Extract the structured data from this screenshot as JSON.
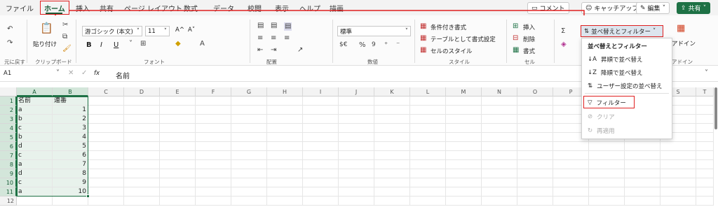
{
  "tabs": [
    "ファイル",
    "ホーム",
    "挿入",
    "共有",
    "ページ レイアウト",
    "数式",
    "データ",
    "校閲",
    "表示",
    "ヘルプ",
    "描画"
  ],
  "top_buttons": {
    "comment": "コメント",
    "catchup": "キャッチアップ",
    "edit": "編集",
    "share": "共有"
  },
  "ribbon": {
    "undo_group": "元に戻す",
    "clipboard": {
      "paste": "貼り付け",
      "label": "クリップボード"
    },
    "font": {
      "name": "游ゴシック (本文)",
      "size": "11",
      "label": "フォント",
      "grow": "A^",
      "shrink": "A˅",
      "bold": "B",
      "italic": "I",
      "underline": "U"
    },
    "alignment": {
      "label": "配置"
    },
    "number": {
      "format": "標準",
      "label": "数値"
    },
    "styles": {
      "conditional": "条件付き書式",
      "table": "テーブルとして書式設定",
      "cell_styles": "セルのスタイル",
      "label": "スタイル"
    },
    "cells": {
      "insert": "挿入",
      "delete": "削除",
      "format": "書式",
      "label": "セル"
    },
    "editing": {
      "sort_filter": "並べ替えとフィルター"
    },
    "addins": {
      "label": "アドイン",
      "label2": "アドイン"
    }
  },
  "formula_bar": {
    "name_box": "A1",
    "fx": "fx",
    "content": "名前"
  },
  "grid": {
    "columns": [
      "A",
      "B",
      "C",
      "D",
      "E",
      "F",
      "G",
      "H",
      "I",
      "J",
      "K",
      "L",
      "M",
      "N",
      "O",
      "P",
      "Q",
      "R",
      "S",
      "T"
    ],
    "rows": [
      "1",
      "2",
      "3",
      "4",
      "5",
      "6",
      "7",
      "8",
      "9",
      "10",
      "11",
      "12"
    ],
    "headers": [
      "名前",
      "連番"
    ],
    "data": [
      [
        "a",
        "1"
      ],
      [
        "b",
        "2"
      ],
      [
        "c",
        "3"
      ],
      [
        "b",
        "4"
      ],
      [
        "d",
        "5"
      ],
      [
        "c",
        "6"
      ],
      [
        "a",
        "7"
      ],
      [
        "d",
        "8"
      ],
      [
        "c",
        "9"
      ],
      [
        "a",
        "10"
      ]
    ]
  },
  "dropdown": {
    "title": "並べ替えとフィルター",
    "asc": "昇順で並べ替え",
    "desc": "降順で並べ替え",
    "custom": "ユーザー設定の並べ替え",
    "filter": "フィルター",
    "clear": "クリア",
    "reapply": "再適用"
  },
  "colors": {
    "accent": "#185c37",
    "highlight": "#e02020",
    "share": "#1e7145"
  }
}
